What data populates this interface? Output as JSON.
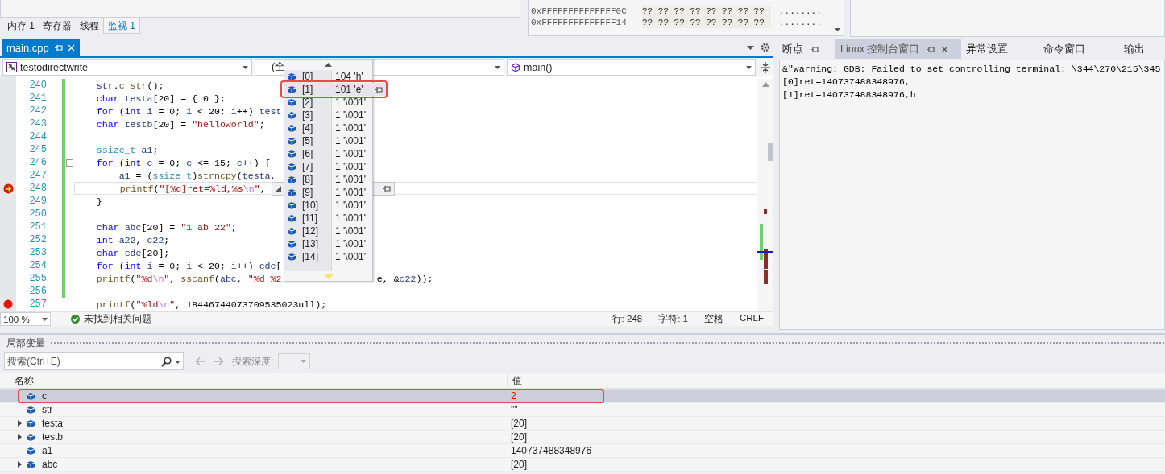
{
  "watch_panel": {
    "tabs": [
      {
        "label": "内存 1",
        "selected": false
      },
      {
        "label": "寄存器",
        "selected": false
      },
      {
        "label": "线程",
        "selected": false
      },
      {
        "label": "监视 1",
        "selected": true
      }
    ]
  },
  "memory": {
    "rows": [
      {
        "address": "0xFFFFFFFFFFFFFF0C",
        "bytes": "?? ?? ?? ?? ?? ?? ?? ??",
        "chars": "........"
      },
      {
        "address": "0xFFFFFFFFFFFFFF14",
        "bytes": "?? ?? ?? ?? ?? ?? ?? ??",
        "chars": "........"
      }
    ]
  },
  "editor": {
    "tab": {
      "label": "main.cpp",
      "selected": true
    },
    "nav": {
      "project": "testodirectwrite",
      "scope": "(全",
      "member": "main()"
    },
    "lines": [
      {
        "number": "240",
        "changed": true,
        "tokens": [
          {
            "kind": "var",
            "text": "    str"
          },
          {
            "kind": "plain",
            "text": "."
          },
          {
            "kind": "func",
            "text": "c_str"
          },
          {
            "kind": "plain",
            "text": "();"
          }
        ]
      },
      {
        "number": "241",
        "changed": true,
        "tokens": [
          {
            "kind": "keyword",
            "text": "    char"
          },
          {
            "kind": "var",
            "text": " testa"
          },
          {
            "kind": "plain",
            "text": "[20] = { 0 };"
          }
        ]
      },
      {
        "number": "242",
        "changed": true,
        "tokens": [
          {
            "kind": "keyword",
            "text": "    for"
          },
          {
            "kind": "plain",
            "text": " ("
          },
          {
            "kind": "keyword",
            "text": "int"
          },
          {
            "kind": "var",
            "text": " i"
          },
          {
            "kind": "plain",
            "text": " = 0; "
          },
          {
            "kind": "var",
            "text": "i"
          },
          {
            "kind": "plain",
            "text": " < 20; "
          },
          {
            "kind": "var",
            "text": "i"
          },
          {
            "kind": "plain",
            "text": "++) "
          },
          {
            "kind": "var",
            "text": "test"
          }
        ]
      },
      {
        "number": "243",
        "changed": true,
        "tokens": [
          {
            "kind": "keyword",
            "text": "    char"
          },
          {
            "kind": "var",
            "text": " testb"
          },
          {
            "kind": "plain",
            "text": "[20] = "
          },
          {
            "kind": "string",
            "text": "\"helloworld\""
          },
          {
            "kind": "plain",
            "text": ";"
          }
        ]
      },
      {
        "number": "244",
        "changed": true
      },
      {
        "number": "245",
        "changed": true,
        "tokens": [
          {
            "kind": "type",
            "text": "    ssize_t"
          },
          {
            "kind": "var",
            "text": " a1"
          },
          {
            "kind": "plain",
            "text": ";"
          }
        ]
      },
      {
        "number": "246",
        "changed": true,
        "fold": true,
        "tokens": [
          {
            "kind": "keyword",
            "text": "    for"
          },
          {
            "kind": "plain",
            "text": " ("
          },
          {
            "kind": "keyword",
            "text": "int"
          },
          {
            "kind": "var",
            "text": " c"
          },
          {
            "kind": "plain",
            "text": " = 0; "
          },
          {
            "kind": "var",
            "text": "c"
          },
          {
            "kind": "plain",
            "text": " <= 15; "
          },
          {
            "kind": "var",
            "text": "c"
          },
          {
            "kind": "plain",
            "text": "++) {"
          }
        ]
      },
      {
        "number": "247",
        "changed": true,
        "tokens": [
          {
            "kind": "var",
            "text": "        a1"
          },
          {
            "kind": "plain",
            "text": " = ("
          },
          {
            "kind": "type",
            "text": "ssize_t"
          },
          {
            "kind": "plain",
            "text": ")"
          },
          {
            "kind": "func",
            "text": "strncpy"
          },
          {
            "kind": "plain",
            "text": "("
          },
          {
            "kind": "var",
            "text": "testa"
          },
          {
            "kind": "plain",
            "text": ","
          }
        ]
      },
      {
        "number": "248",
        "changed": true,
        "breakpoint": true,
        "current": true,
        "tokens": [
          {
            "kind": "func",
            "text": "        printf"
          },
          {
            "kind": "plain",
            "text": "("
          },
          {
            "kind": "string",
            "text": "\"[%d]ret=%ld,%s"
          },
          {
            "kind": "escape",
            "text": "\\n"
          },
          {
            "kind": "string",
            "text": "\""
          },
          {
            "kind": "plain",
            "text": ","
          }
        ]
      },
      {
        "number": "249",
        "changed": true,
        "tokens": [
          {
            "kind": "plain",
            "text": "    }"
          }
        ]
      },
      {
        "number": "250",
        "changed": true
      },
      {
        "number": "251",
        "changed": true,
        "tokens": [
          {
            "kind": "keyword",
            "text": "    char"
          },
          {
            "kind": "var",
            "text": " abc"
          },
          {
            "kind": "plain",
            "text": "[20] = "
          },
          {
            "kind": "string",
            "text": "\"1 ab 22\""
          },
          {
            "kind": "plain",
            "text": ";"
          }
        ]
      },
      {
        "number": "252",
        "changed": true,
        "tokens": [
          {
            "kind": "keyword",
            "text": "    int"
          },
          {
            "kind": "var",
            "text": " a22"
          },
          {
            "kind": "plain",
            "text": ", "
          },
          {
            "kind": "var",
            "text": "c22"
          },
          {
            "kind": "plain",
            "text": ";"
          }
        ]
      },
      {
        "number": "253",
        "changed": true,
        "tokens": [
          {
            "kind": "keyword",
            "text": "    char"
          },
          {
            "kind": "var",
            "text": " cde"
          },
          {
            "kind": "plain",
            "text": "[20];"
          }
        ]
      },
      {
        "number": "254",
        "changed": true,
        "tokens": [
          {
            "kind": "keyword",
            "text": "    for"
          },
          {
            "kind": "plain",
            "text": " ("
          },
          {
            "kind": "keyword",
            "text": "int"
          },
          {
            "kind": "var",
            "text": " i"
          },
          {
            "kind": "plain",
            "text": " = 0; "
          },
          {
            "kind": "var",
            "text": "i"
          },
          {
            "kind": "plain",
            "text": " < 20; "
          },
          {
            "kind": "var",
            "text": "i"
          },
          {
            "kind": "plain",
            "text": "++) "
          },
          {
            "kind": "var",
            "text": "cde"
          },
          {
            "kind": "plain",
            "text": "["
          }
        ]
      },
      {
        "number": "255",
        "changed": true,
        "tokens": [
          {
            "kind": "func",
            "text": "    printf"
          },
          {
            "kind": "plain",
            "text": "("
          },
          {
            "kind": "string",
            "text": "\"%d"
          },
          {
            "kind": "escape",
            "text": "\\n"
          },
          {
            "kind": "string",
            "text": "\""
          },
          {
            "kind": "plain",
            "text": ", "
          },
          {
            "kind": "func",
            "text": "sscanf"
          },
          {
            "kind": "plain",
            "text": "("
          },
          {
            "kind": "var",
            "text": "abc"
          },
          {
            "kind": "plain",
            "text": ", "
          },
          {
            "kind": "string",
            "text": "\"%d %2"
          }
        ],
        "tail": [
          {
            "kind": "plain",
            "text": "e, &"
          },
          {
            "kind": "var",
            "text": "c22"
          },
          {
            "kind": "plain",
            "text": "));"
          }
        ]
      },
      {
        "number": "256",
        "changed": true
      },
      {
        "number": "257",
        "changed": false,
        "breakpoint": true,
        "tokens": [
          {
            "kind": "func",
            "text": "    printf"
          },
          {
            "kind": "plain",
            "text": "("
          },
          {
            "kind": "string",
            "text": "\"%ld"
          },
          {
            "kind": "escape",
            "text": "\\n"
          },
          {
            "kind": "string",
            "text": "\""
          },
          {
            "kind": "plain",
            "text": ", 18446744073709535023ull);"
          }
        ]
      }
    ],
    "status": {
      "zoom": "100 %",
      "issues": "未找到相关问题",
      "line": "行: 248",
      "column": "字符: 1",
      "whitespace": "空格",
      "line_ending": "CRLF"
    }
  },
  "datatip": {
    "items": [
      {
        "index": "[0]",
        "value": "104 'h'",
        "highlighted": false
      },
      {
        "index": "[1]",
        "value": "101 'e'",
        "highlighted": true
      },
      {
        "index": "[2]",
        "value": "1 '\\001'",
        "highlighted": false
      },
      {
        "index": "[3]",
        "value": "1 '\\001'",
        "highlighted": false
      },
      {
        "index": "[4]",
        "value": "1 '\\001'",
        "highlighted": false
      },
      {
        "index": "[5]",
        "value": "1 '\\001'",
        "highlighted": false
      },
      {
        "index": "[6]",
        "value": "1 '\\001'",
        "highlighted": false
      },
      {
        "index": "[7]",
        "value": "1 '\\001'",
        "highlighted": false
      },
      {
        "index": "[8]",
        "value": "1 '\\001'",
        "highlighted": false
      },
      {
        "index": "[9]",
        "value": "1 '\\001'",
        "highlighted": false
      },
      {
        "index": "[10]",
        "value": "1 '\\001'",
        "highlighted": false
      },
      {
        "index": "[11]",
        "value": "1 '\\001'",
        "highlighted": false
      },
      {
        "index": "[12]",
        "value": "1 '\\001'",
        "highlighted": false
      },
      {
        "index": "[13]",
        "value": "1 '\\001'",
        "highlighted": false
      },
      {
        "index": "[14]",
        "value": "1 '\\001'",
        "highlighted": false
      }
    ]
  },
  "output_panel": {
    "tabs": [
      {
        "label": "断点",
        "selected": false,
        "pinned": true
      },
      {
        "label": "Linux 控制台窗口",
        "selected": true,
        "pinned": true
      },
      {
        "label": "异常设置",
        "selected": false,
        "pinned": false
      },
      {
        "label": "命令窗口",
        "selected": false,
        "pinned": false
      },
      {
        "label": "输出",
        "selected": false,
        "pinned": false
      }
    ],
    "lines": [
      "&\"warning: GDB: Failed to set controlling terminal: \\344\\270\\215\\345",
      "[0]ret=140737488348976,",
      "[1]ret=140737488348976,h"
    ]
  },
  "locals": {
    "title": "局部变量",
    "search": {
      "placeholder": "搜索(Ctrl+E)"
    },
    "depth_label": "搜索深度:",
    "columns": [
      "名称",
      "值"
    ],
    "rows": [
      {
        "name": "c",
        "value": "2",
        "expandable": false,
        "selected": true,
        "changed": true,
        "highlighted": true
      },
      {
        "name": "str",
        "value": "\"\"",
        "expandable": false,
        "selected": false,
        "changed": false,
        "highlighted": false
      },
      {
        "name": "testa",
        "value": "[20]",
        "expandable": true,
        "selected": false,
        "changed": false,
        "highlighted": false
      },
      {
        "name": "testb",
        "value": "[20]",
        "expandable": true,
        "selected": false,
        "changed": false,
        "highlighted": false
      },
      {
        "name": "a1",
        "value": "140737488348976",
        "expandable": false,
        "selected": false,
        "changed": false,
        "highlighted": false
      },
      {
        "name": "abc",
        "value": "[20]",
        "expandable": true,
        "selected": false,
        "changed": false,
        "highlighted": false
      }
    ]
  }
}
